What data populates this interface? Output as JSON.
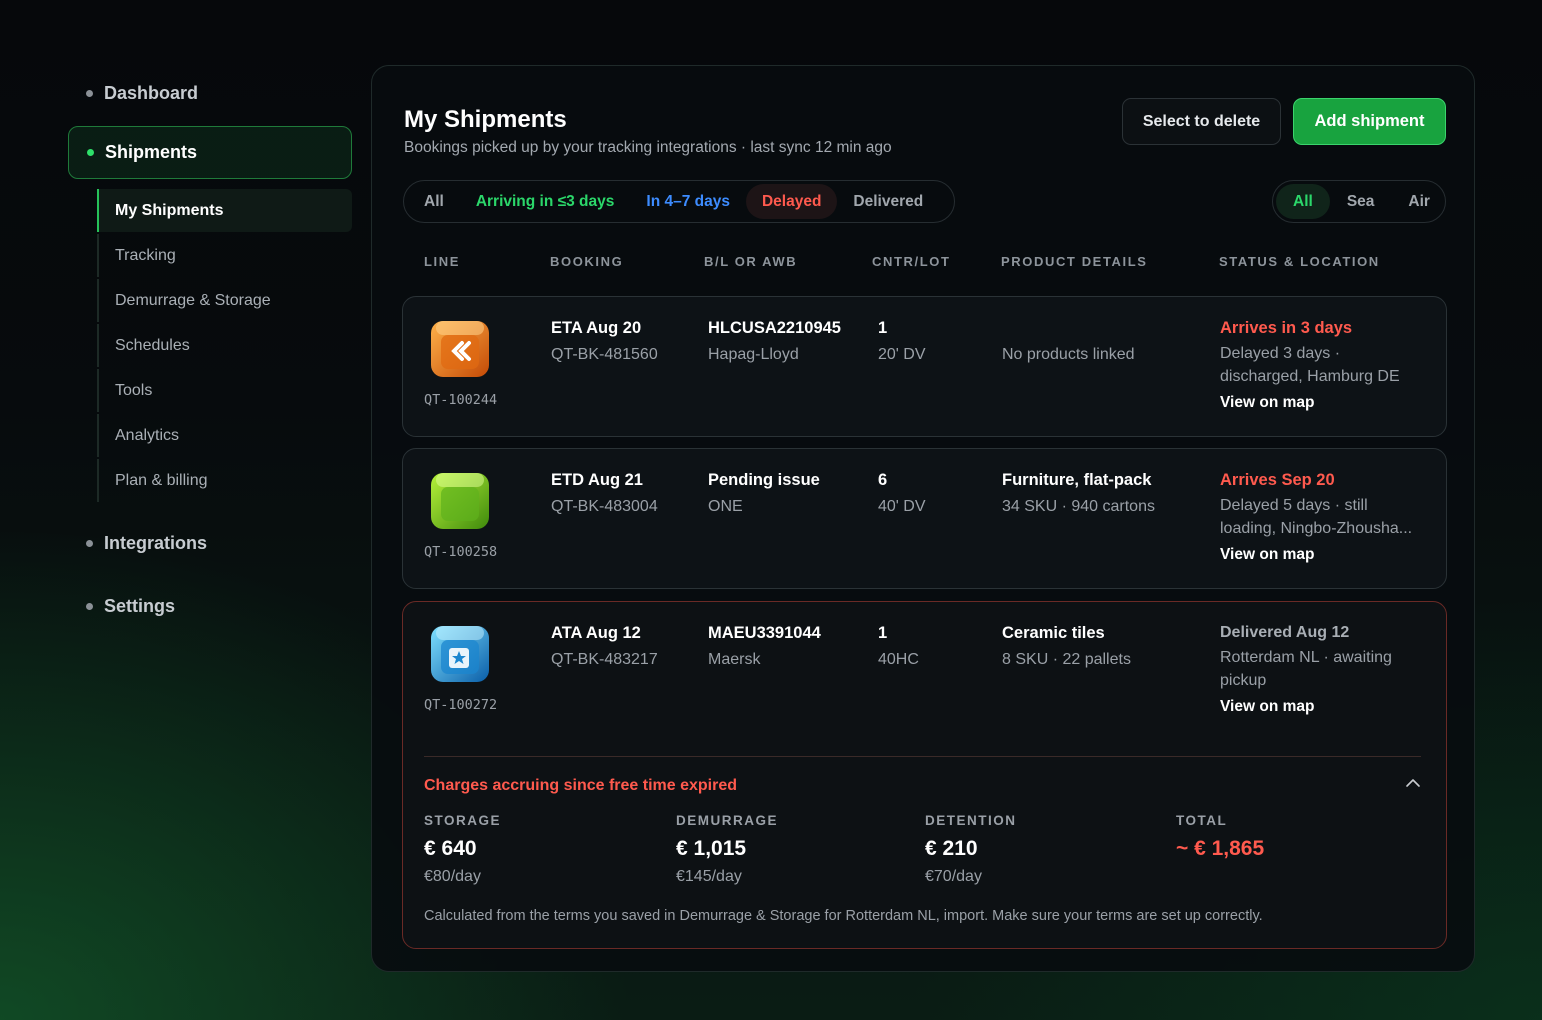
{
  "sidebar": {
    "dashboard": "Dashboard",
    "shipments": "Shipments",
    "sub_items": [
      "My Shipments",
      "Tracking",
      "Demurrage & Storage",
      "Schedules",
      "Tools",
      "Analytics",
      "Plan & billing"
    ],
    "integrations": "Integrations",
    "settings": "Settings"
  },
  "header": {
    "title": "My Shipments",
    "subtitle": "Bookings picked up by your tracking integrations · last sync 12 min ago",
    "delete_label": "Select to delete",
    "add_label": "Add shipment"
  },
  "filters": [
    "All",
    "Arriving in ≤3 days",
    "In 4–7 days",
    "Delayed",
    "Delivered"
  ],
  "mode_filters": [
    "All",
    "Sea",
    "Air"
  ],
  "columns": [
    "LINE",
    "BOOKING",
    "B/L OR AWB",
    "CNTR/LOT",
    "PRODUCT DETAILS",
    "STATUS & LOCATION"
  ],
  "shipments": [
    {
      "ref": "QT-100244",
      "icon": "orange-cube-icon",
      "booking_date": "ETA Aug 20",
      "booking_id": "QT-BK-481560",
      "bl": "HLCUSA2210945",
      "carrier": "Hapag-Lloyd",
      "cntr_count": "1",
      "cntr_type": "20' DV",
      "product_title": "",
      "product_sub": "No products linked",
      "status": "Arrives in 3 days",
      "status_detail": "Delayed 3 days · discharged, Hamburg DE",
      "map_label": "View on map"
    },
    {
      "ref": "QT-100258",
      "icon": "green-cube-icon",
      "booking_date": "ETD Aug 21",
      "booking_id": "QT-BK-483004",
      "bl": "Pending issue",
      "carrier": "ONE",
      "cntr_count": "6",
      "cntr_type": "40' DV",
      "product_title": "Furniture, flat-pack",
      "product_sub": "34 SKU · 940 cartons",
      "status": "Arrives Sep 20",
      "status_detail": "Delayed 5 days · still loading, Ningbo-Zhousha...",
      "map_label": "View on map"
    },
    {
      "ref": "QT-100272",
      "icon": "blue-cube-icon",
      "booking_date": "ATA Aug 12",
      "booking_id": "QT-BK-483217",
      "bl": "MAEU3391044",
      "carrier": "Maersk",
      "cntr_count": "1",
      "cntr_type": "40HC",
      "product_title": "Ceramic tiles",
      "product_sub": "8 SKU · 22 pallets",
      "status": "Delivered Aug 12",
      "status_detail": "Rotterdam NL · awaiting pickup",
      "map_label": "View on map"
    }
  ],
  "charges": {
    "title": "Charges accruing since free time expired",
    "storage_label": "STORAGE",
    "storage_value": "€ 640",
    "storage_rate": "€80/day",
    "demurrage_label": "DEMURRAGE",
    "demurrage_value": "€ 1,015",
    "demurrage_rate": "€145/day",
    "detention_label": "DETENTION",
    "detention_value": "€ 210",
    "detention_rate": "€70/day",
    "total_label": "TOTAL",
    "total_value": "~ € 1,865",
    "note": "Calculated from the terms you saved in Demurrage & Storage for Rotterdam NL, import. Make sure your terms are set up correctly."
  },
  "colors": {
    "accent_green": "#2bd76a",
    "alert_red": "#ff5a4e",
    "link_blue": "#3d8cff"
  }
}
